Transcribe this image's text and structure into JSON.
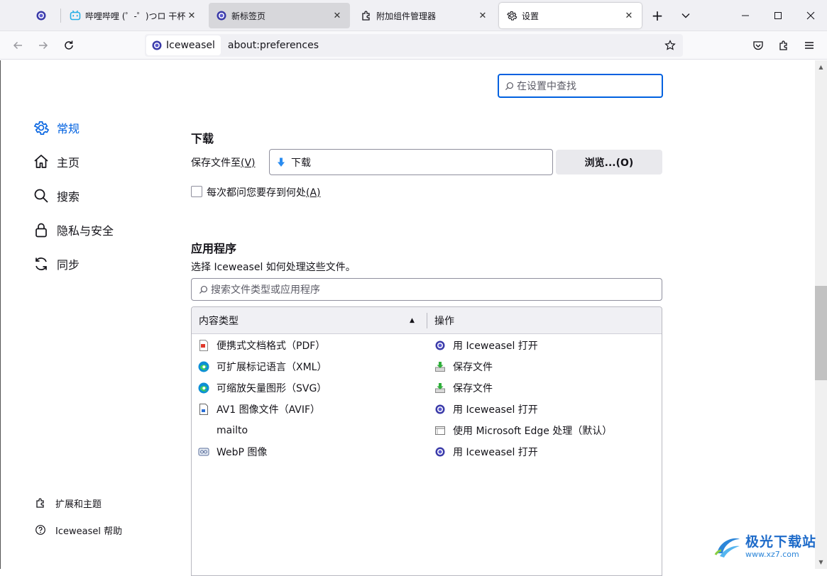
{
  "tabs": [
    {
      "title": "",
      "icon": "iceweasel-globe-icon"
    },
    {
      "title": "哔哩哔哩 (゜-゜)つロ 干杯~",
      "icon": "bilibili-icon"
    },
    {
      "title": "新标签页",
      "icon": "iceweasel-globe-icon"
    },
    {
      "title": "附加组件管理器",
      "icon": "puzzle-icon"
    },
    {
      "title": "设置",
      "icon": "gear-icon"
    }
  ],
  "tab_close_glyph": "✕",
  "new_tab_glyph": "+",
  "urlbar": {
    "identity_label": "Iceweasel",
    "url": "about:preferences"
  },
  "search": {
    "placeholder": "在设置中查找"
  },
  "sidebar": {
    "categories": [
      {
        "label": "常规",
        "icon": "gear-icon",
        "active": true
      },
      {
        "label": "主页",
        "icon": "home-icon"
      },
      {
        "label": "搜索",
        "icon": "search-icon"
      },
      {
        "label": "隐私与安全",
        "icon": "lock-icon"
      },
      {
        "label": "同步",
        "icon": "sync-icon"
      }
    ],
    "footer": [
      {
        "label": "扩展和主题",
        "icon": "puzzle-icon"
      },
      {
        "label": "Iceweasel 帮助",
        "icon": "help-icon"
      }
    ]
  },
  "downloads": {
    "title": "下载",
    "save_label": "保存文件至",
    "save_accesskey": "(V)",
    "folder": "下载",
    "browse_button": "浏览...(O)",
    "ask_label": "每次都问您要存到何处",
    "ask_accesskey": "(A)",
    "ask_checked": false
  },
  "applications": {
    "title": "应用程序",
    "description": "选择 Iceweasel 如何处理这些文件。",
    "filter_placeholder": "搜索文件类型或应用程序",
    "columns": [
      "内容类型",
      "操作"
    ],
    "sort_glyph": "▲",
    "rows": [
      {
        "type": "便携式文档格式（PDF）",
        "type_icon": "pdf-icon",
        "action": "用 Iceweasel 打开",
        "action_icon": "iceweasel-globe-icon"
      },
      {
        "type": "可扩展标记语言（XML）",
        "type_icon": "edge-icon",
        "action": "保存文件",
        "action_icon": "save-download-icon"
      },
      {
        "type": "可缩放矢量图形（SVG）",
        "type_icon": "edge-icon",
        "action": "保存文件",
        "action_icon": "save-download-icon"
      },
      {
        "type": "AV1 图像文件（AVIF）",
        "type_icon": "image-file-icon",
        "action": "用 Iceweasel 打开",
        "action_icon": "iceweasel-globe-icon"
      },
      {
        "type": "mailto",
        "type_icon": "",
        "action": "使用 Microsoft Edge 处理（默认）",
        "action_icon": "window-app-icon"
      },
      {
        "type": "WebP 图像",
        "type_icon": "webp-file-icon",
        "action": "用 Iceweasel 打开",
        "action_icon": "iceweasel-globe-icon"
      }
    ]
  },
  "watermark": {
    "main": "极光下载站",
    "sub": "www.xz7.com"
  },
  "colors": {
    "accent": "#0061e0",
    "tab_strip": "#f0f0f4",
    "button_bg": "#e9e9ed"
  }
}
